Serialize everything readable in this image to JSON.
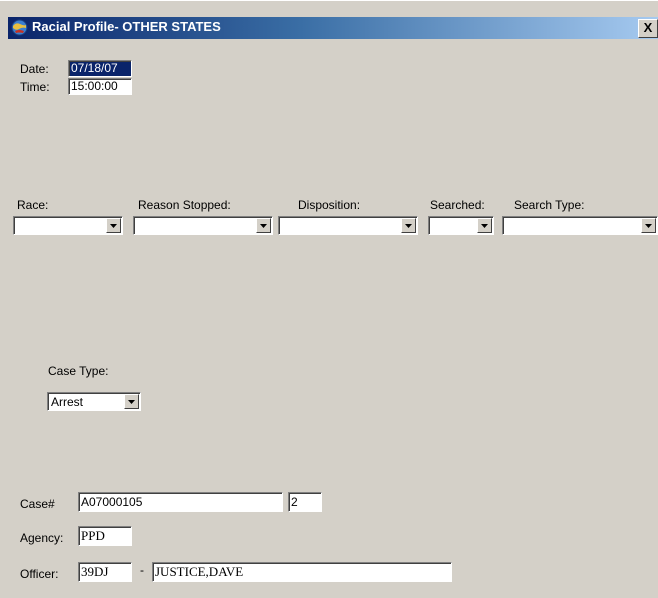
{
  "window": {
    "title": "Racial Profile- OTHER STATES",
    "close_glyph": "X"
  },
  "date": {
    "label": "Date:",
    "value": "07/18/07"
  },
  "time": {
    "label": "Time:",
    "value": "15:00:00"
  },
  "race": {
    "label": "Race:",
    "value": ""
  },
  "reason_stopped": {
    "label": "Reason Stopped:",
    "value": ""
  },
  "disposition": {
    "label": "Disposition:",
    "value": ""
  },
  "searched": {
    "label": "Searched:",
    "value": ""
  },
  "search_type": {
    "label": "Search Type:",
    "value": ""
  },
  "case_type": {
    "label": "Case Type:",
    "value": "Arrest"
  },
  "case": {
    "label": "Case#",
    "number": "A07000105",
    "suffix": "2"
  },
  "agency": {
    "label": "Agency:",
    "value": "PPD"
  },
  "officer": {
    "label": "Officer:",
    "id": "39DJ",
    "separator": "-",
    "name": "JUSTICE,DAVE"
  }
}
